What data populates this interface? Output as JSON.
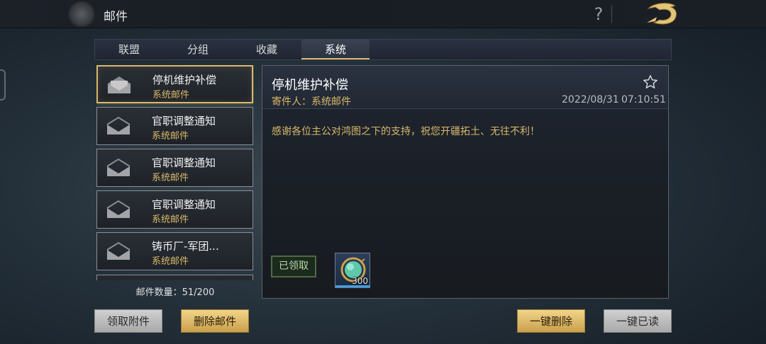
{
  "header": {
    "title": "邮件",
    "help_label": "?"
  },
  "tabs": [
    {
      "label": "联盟"
    },
    {
      "label": "分组"
    },
    {
      "label": "收藏"
    },
    {
      "label": "系统",
      "active": true
    }
  ],
  "mail_list": {
    "items": [
      {
        "title": "停机维护补偿",
        "sender": "系统邮件",
        "selected": true
      },
      {
        "title": "官职调整通知",
        "sender": "系统邮件"
      },
      {
        "title": "官职调整通知",
        "sender": "系统邮件"
      },
      {
        "title": "官职调整通知",
        "sender": "系统邮件"
      },
      {
        "title": "铸币厂-军团...",
        "sender": "系统邮件"
      }
    ],
    "count_label": "邮件数量：51/200"
  },
  "detail": {
    "title": "停机维护补偿",
    "sender_label": "寄件人：系统邮件",
    "date": "2022/08/31",
    "time": "07:10:51",
    "body": "感谢各位主公对鸿图之下的支持，祝您开疆拓土、无往不利！",
    "claimed_label": "已领取",
    "reward": {
      "icon": "jade-gem-icon",
      "count": "300"
    }
  },
  "buttons": {
    "claim_attachments": "领取附件",
    "delete_mail": "删除邮件",
    "delete_all": "一键删除",
    "read_all": "一键已读"
  },
  "colors": {
    "accent_gold": "#d8b86a",
    "claimed_green": "#b9d8a8"
  }
}
